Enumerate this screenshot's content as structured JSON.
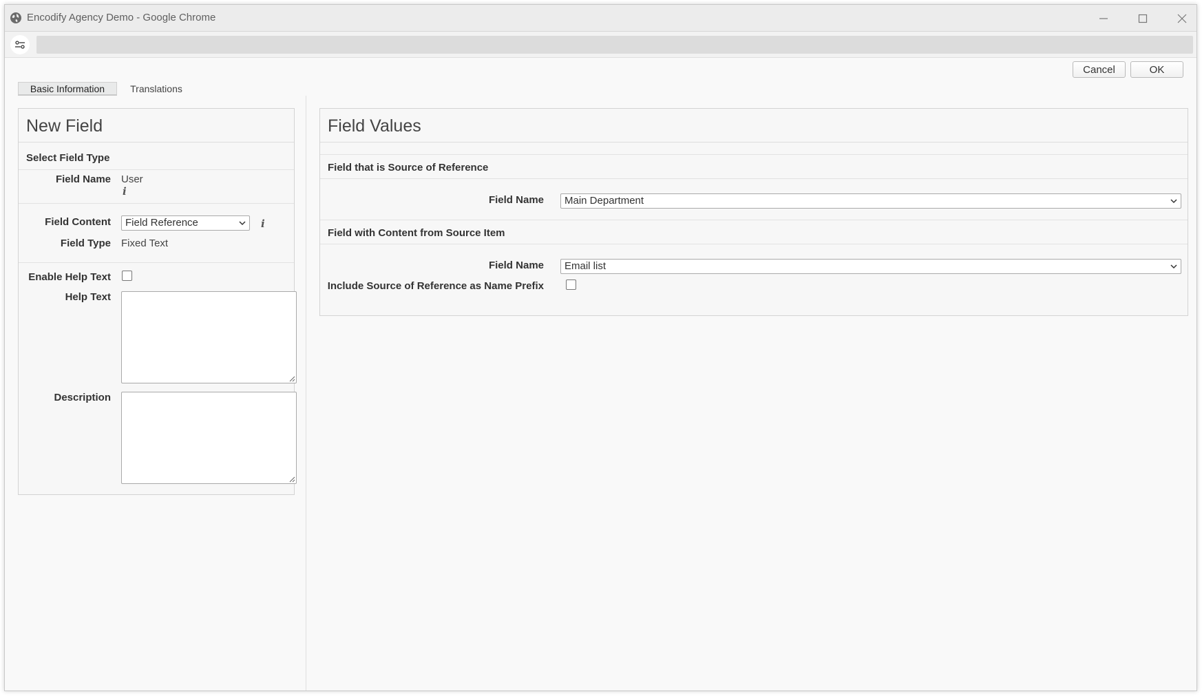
{
  "window": {
    "title": "Encodify Agency Demo - Google Chrome"
  },
  "toolbar": {
    "cancel_label": "Cancel",
    "ok_label": "OK"
  },
  "tabs": [
    {
      "label": "Basic Information",
      "active": true
    },
    {
      "label": "Translations",
      "active": false
    }
  ],
  "new_field": {
    "title": "New Field",
    "select_field_type": "Select Field Type",
    "field_name_label": "Field Name",
    "field_name_value": "User",
    "field_content_label": "Field Content",
    "field_content_value": "Field Reference",
    "field_type_label": "Field Type",
    "field_type_value": "Fixed Text",
    "enable_help_text_label": "Enable Help Text",
    "help_text_label": "Help Text",
    "description_label": "Description"
  },
  "field_values": {
    "title": "Field Values",
    "source_section": "Field that is Source of Reference",
    "source_field_name_label": "Field Name",
    "source_field_name_value": "Main Department",
    "content_section": "Field with Content from Source Item",
    "content_field_name_label": "Field Name",
    "content_field_name_value": "Email list",
    "include_prefix_label": "Include Source of Reference as Name Prefix"
  },
  "edge_glyph": "s",
  "icons": {
    "globe": "globe-icon",
    "tune": "tune-icon",
    "info": "info-icon"
  }
}
